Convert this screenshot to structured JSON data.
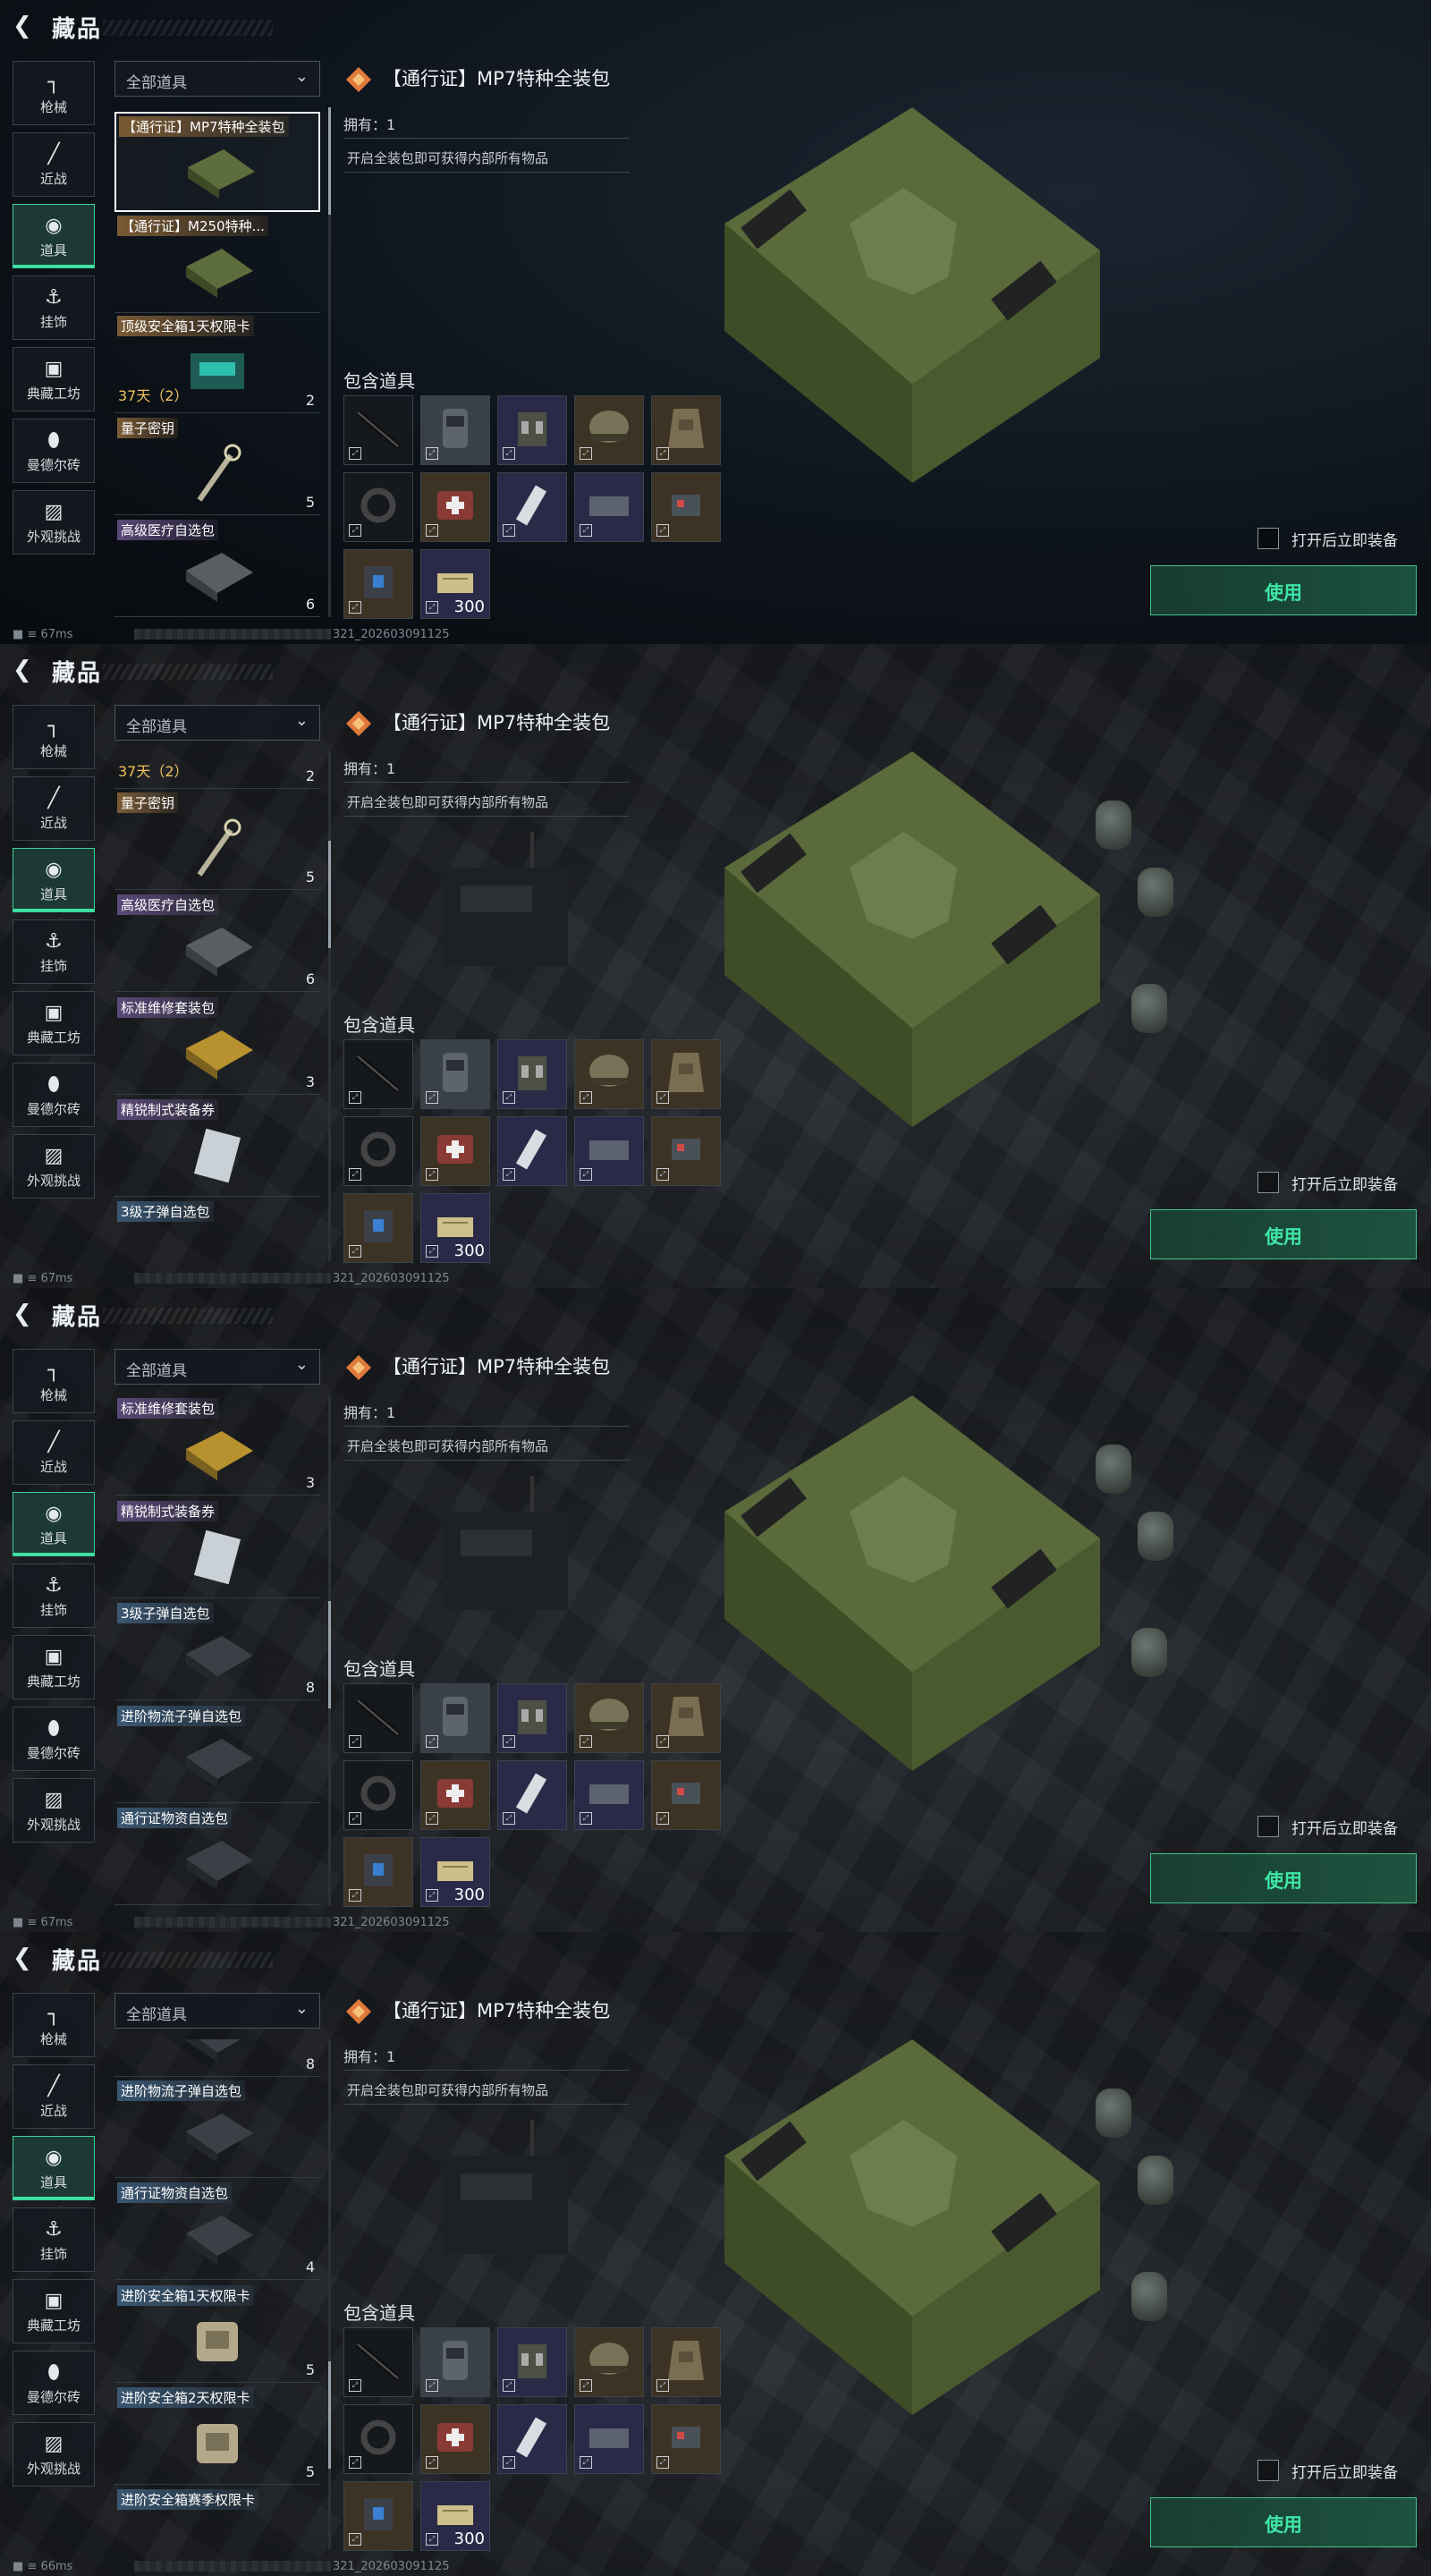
{
  "header": {
    "title": "藏品",
    "back_icon": "back-arrow-icon"
  },
  "categories": [
    {
      "label": "枪械",
      "icon": "gun-icon"
    },
    {
      "label": "近战",
      "icon": "knife-icon"
    },
    {
      "label": "道具",
      "icon": "items-icon",
      "active": true
    },
    {
      "label": "挂饰",
      "icon": "charm-icon"
    },
    {
      "label": "典藏工坊",
      "icon": "workshop-icon"
    },
    {
      "label": "曼德尔砖",
      "icon": "mandel-brick-icon"
    },
    {
      "label": "外观挑战",
      "icon": "challenge-icon"
    }
  ],
  "filter": {
    "label": "全部道具"
  },
  "items": {
    "i0": {
      "name": "【通行证】MP7特种全装包"
    },
    "i1": {
      "name": "【通行证】M250特种..."
    },
    "i2": {
      "name": "顶级安全箱1天权限卡",
      "count": "2",
      "time": "37天（2）"
    },
    "i3": {
      "name": "量子密钥",
      "count": "5"
    },
    "i4": {
      "name": "高级医疗自选包",
      "count": "6"
    },
    "i5": {
      "name": "标准维修套装包",
      "count": "3"
    },
    "i6": {
      "name": "精锐制式装备券"
    },
    "i7": {
      "name": "3级子弹自选包",
      "count": "8"
    },
    "i8": {
      "name": "进阶物流子弹自选包"
    },
    "i9": {
      "name": "通行证物资自选包",
      "count": "4"
    },
    "i10": {
      "name": "进阶安全箱1天权限卡",
      "count": "5"
    },
    "i11": {
      "name": "进阶安全箱2天权限卡",
      "count": "5"
    },
    "i12": {
      "name": "进阶安全箱赛季权限卡"
    }
  },
  "detail": {
    "title": "【通行证】MP7特种全装包",
    "owned": "拥有：1",
    "description": "开启全装包即可获得内部所有物品",
    "included_label": "包含道具",
    "included_items": [
      {
        "icon": "mp7-rifle-icon"
      },
      {
        "icon": "backpack-icon"
      },
      {
        "icon": "chest-rig-icon"
      },
      {
        "icon": "helmet-icon"
      },
      {
        "icon": "body-armor-icon"
      },
      {
        "icon": "pouch-strap-icon"
      },
      {
        "icon": "medkit-icon"
      },
      {
        "icon": "bandage-icon"
      },
      {
        "icon": "repair-kit-icon"
      },
      {
        "icon": "injector-icon"
      },
      {
        "icon": "medical-case-icon"
      },
      {
        "icon": "ammo-box-icon",
        "quantity": "300"
      }
    ],
    "auto_equip_label": "打开后立即装备",
    "use_label": "使用"
  },
  "frames": [
    {
      "ping": "67ms",
      "version": "321_202603091125"
    },
    {
      "ping": "67ms",
      "version": "321_202603091125"
    },
    {
      "ping": "67ms",
      "version": "321_202603091125"
    },
    {
      "ping": "66ms",
      "version": "321_202603091125"
    }
  ],
  "colors": {
    "accent": "#3ee6a8",
    "gold_tag": "#7a5b35",
    "purple_tag": "#5b4a78",
    "blue_tag": "#3a5772",
    "timer": "#f0c35c"
  }
}
